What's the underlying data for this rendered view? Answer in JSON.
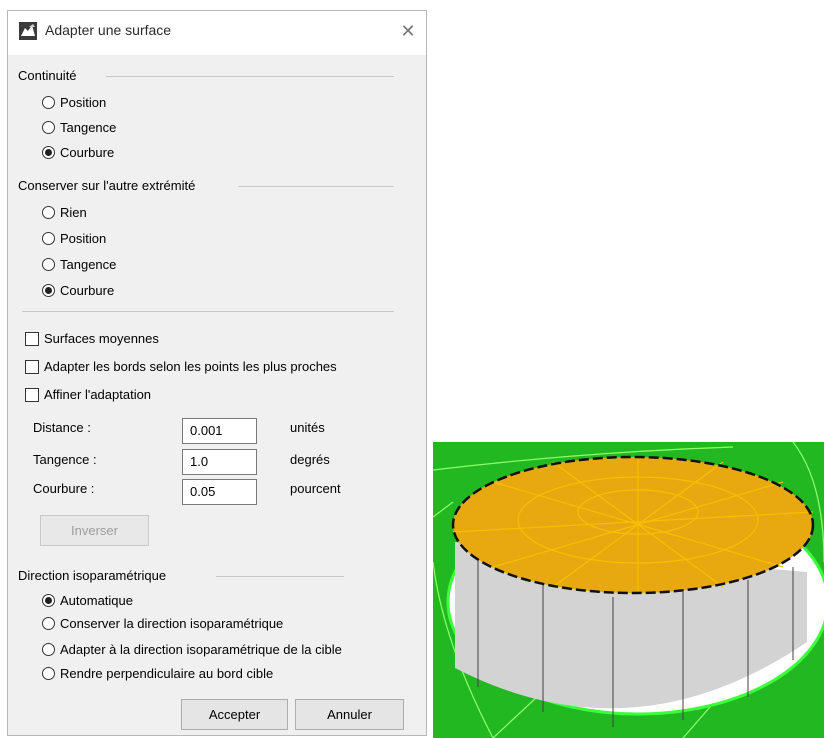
{
  "dialog": {
    "title": "Adapter une surface",
    "close_glyph": "✕",
    "continuity": {
      "label": "Continuité",
      "options": [
        "Position",
        "Tangence",
        "Courbure"
      ],
      "selected": "Courbure"
    },
    "preserve": {
      "label": "Conserver sur l'autre extrémité",
      "options": [
        "Rien",
        "Position",
        "Tangence",
        "Courbure"
      ],
      "selected": "Courbure"
    },
    "checkboxes": [
      {
        "label": "Surfaces moyennes",
        "checked": false
      },
      {
        "label": "Adapter les bords selon les points les plus proches",
        "checked": false
      },
      {
        "label": "Affiner l'adaptation",
        "checked": false
      }
    ],
    "fields": [
      {
        "label": "Distance :",
        "value": "0.001",
        "unit": "unités"
      },
      {
        "label": "Tangence :",
        "value": "1.0",
        "unit": "degrés"
      },
      {
        "label": "Courbure :",
        "value": "0.05",
        "unit": "pourcent"
      }
    ],
    "invert_button": "Inverser",
    "isoparam": {
      "label": "Direction isoparamétrique",
      "options": [
        "Automatique",
        "Conserver la direction isoparamétrique",
        "Adapter à la direction isoparamétrique de la cible",
        "Rendre perpendiculaire au bord cible"
      ],
      "selected": "Automatique"
    },
    "accept_button": "Accepter",
    "cancel_button": "Annuler"
  },
  "colors": {
    "dialog_bg": "#f0f0f0",
    "surface_green": "#22b822",
    "cap_gold": "#e8a810",
    "iso_curve": "#f5c000"
  },
  "icons": {
    "app": "rhino-icon",
    "close": "close-icon"
  }
}
